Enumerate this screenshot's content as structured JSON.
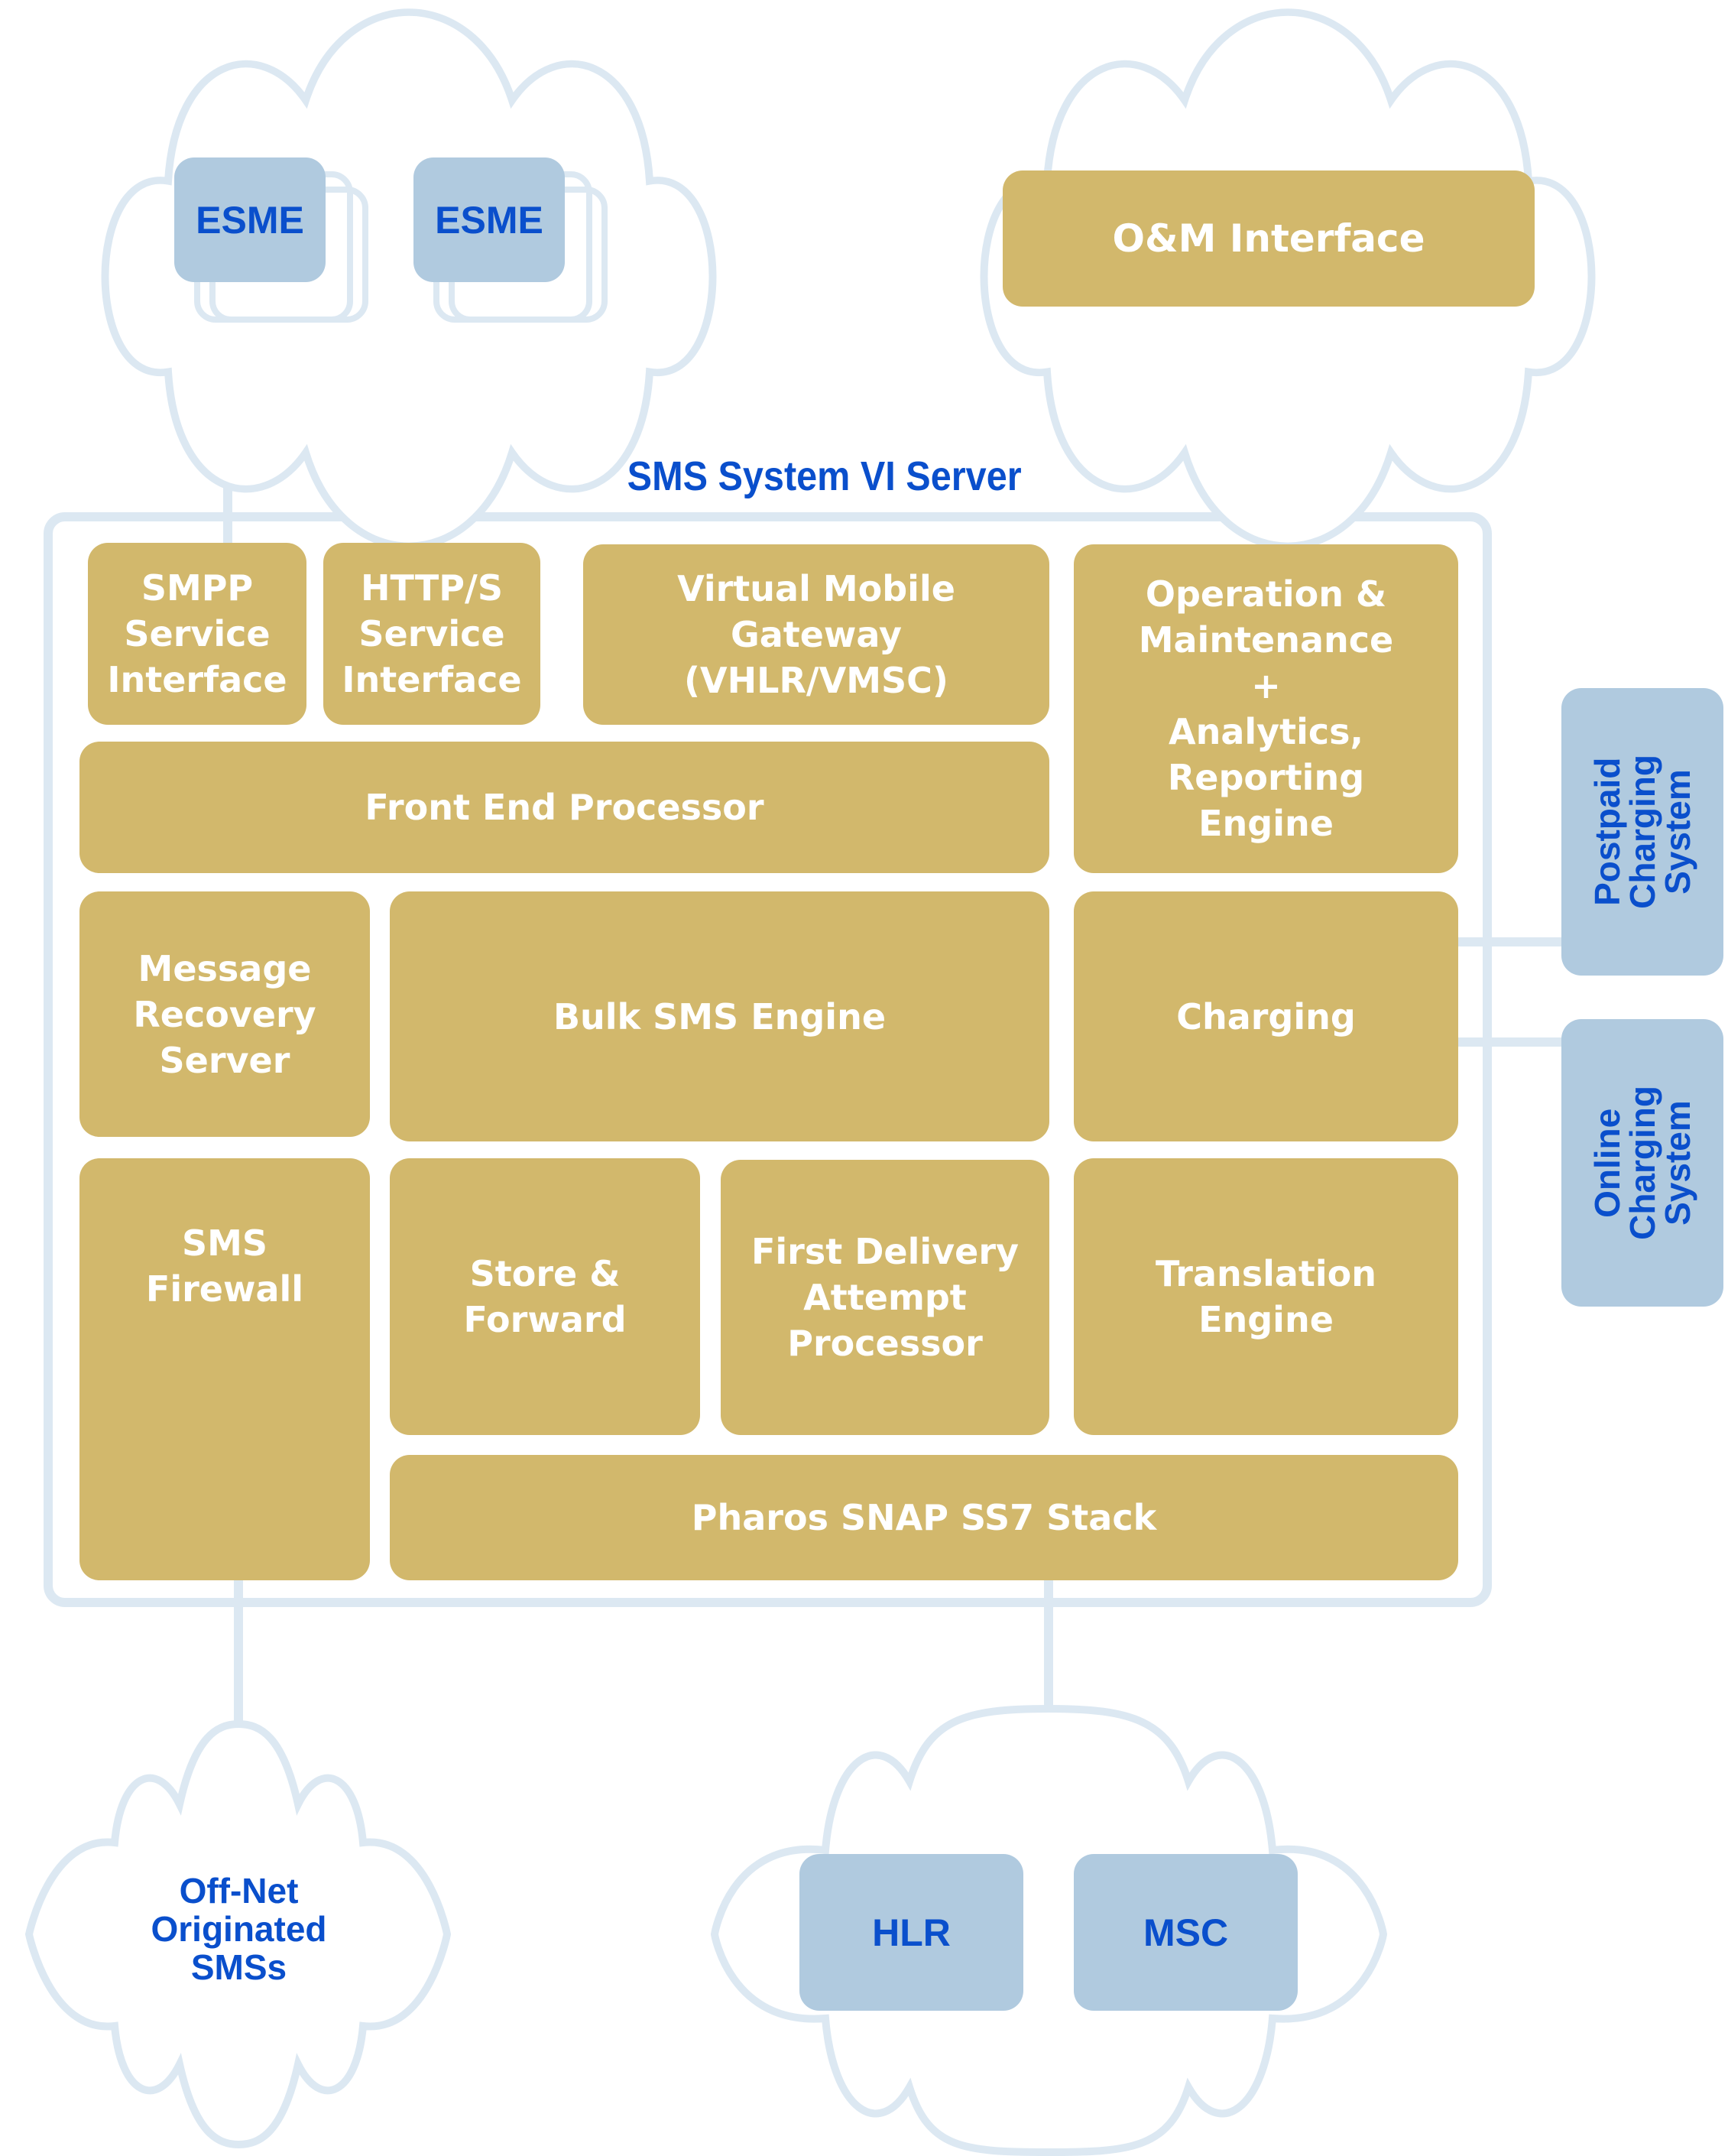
{
  "diagram": {
    "title": "SMS System VI Server",
    "colors": {
      "component_fill": "#d2b86c",
      "component_text": "#ffffff",
      "external_fill": "#b0cadf",
      "external_text": "#0a4fcc",
      "outline": "#dce8f2"
    },
    "external_clouds": {
      "esme_cloud": {
        "items": [
          "ESME",
          "ESME"
        ]
      },
      "om_cloud": {
        "items": [
          "O&M Interface"
        ]
      },
      "offnet_cloud": {
        "label": "Off-Net\nOriginated\nSMSs"
      },
      "network_cloud": {
        "items": [
          "HLR",
          "MSC"
        ]
      }
    },
    "components": {
      "smpp": "SMPP\nService\nInterface",
      "http": "HTTP/S\nService\nInterface",
      "vmg": "Virtual Mobile\nGateway\n(VHLR/VMSC)",
      "om": "Operation &\nMaintenance\n+\nAnalytics,\nReporting\nEngine",
      "fep": "Front End Processor",
      "mrs": "Message\nRecovery\nServer",
      "bulk": "Bulk SMS Engine",
      "charging": "Charging",
      "firewall": "SMS\nFirewall",
      "store": "Store &\nForward",
      "fdap": "First Delivery\nAttempt\nProcessor",
      "translation": "Translation\nEngine",
      "ss7": "Pharos SNAP SS7 Stack"
    },
    "side_systems": {
      "postpaid": "Postpaid\nCharging\nSystem",
      "online": "Online\nCharging\nSystem"
    },
    "connections": [
      {
        "from": "ESME",
        "to": "SMPP Service Interface"
      },
      {
        "from": "ESME",
        "to": "HTTP/S Service Interface"
      },
      {
        "from": "O&M Interface",
        "to": "Operation & Maintenance + Analytics, Reporting Engine"
      },
      {
        "from": "Charging",
        "to": "Postpaid Charging System"
      },
      {
        "from": "Charging",
        "to": "Online Charging System"
      },
      {
        "from": "SMS Firewall",
        "to": "Off-Net Originated SMSs"
      },
      {
        "from": "Pharos SNAP SS7 Stack",
        "to": "HLR / MSC"
      }
    ]
  }
}
